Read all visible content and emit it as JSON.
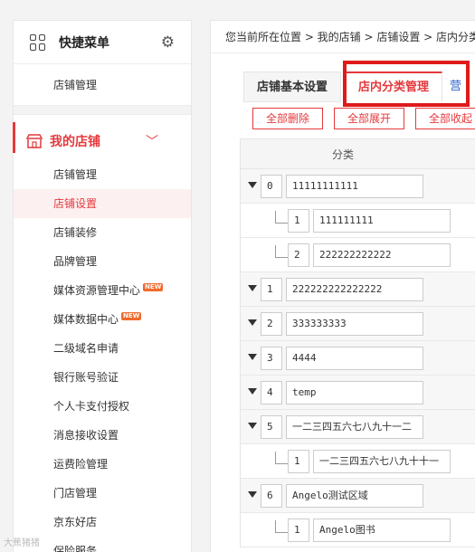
{
  "quick_menu": {
    "title": "快捷菜单",
    "items": [
      {
        "label": "店铺管理"
      }
    ]
  },
  "my_shop": {
    "title": "我的店铺",
    "items": [
      {
        "label": "店铺管理"
      },
      {
        "label": "店铺设置"
      },
      {
        "label": "店铺装修"
      },
      {
        "label": "品牌管理"
      },
      {
        "label": "媒体资源管理中心",
        "badge": "NEW"
      },
      {
        "label": "媒体数据中心",
        "badge": "NEW"
      },
      {
        "label": "二级域名申请"
      },
      {
        "label": "银行账号验证"
      },
      {
        "label": "个人卡支付授权"
      },
      {
        "label": "消息接收设置"
      },
      {
        "label": "运费险管理"
      },
      {
        "label": "门店管理"
      },
      {
        "label": "京东好店"
      },
      {
        "label": "保险服务"
      }
    ]
  },
  "breadcrumb": "您当前所在位置 > 我的店铺 > 店铺设置 > 店内分类",
  "tabs": [
    {
      "label": "店铺基本设置"
    },
    {
      "label": "店内分类管理"
    },
    {
      "label": "营"
    }
  ],
  "actions": {
    "delete_all": "全部删除",
    "expand_all": "全部展开",
    "collapse_all": "全部收起"
  },
  "table": {
    "header": "分类",
    "rows": [
      {
        "sort": "0",
        "name": "11111111111"
      },
      {
        "sort": "1",
        "name": "111111111"
      },
      {
        "sort": "2",
        "name": "222222222222"
      },
      {
        "sort": "1",
        "name": "222222222222222"
      },
      {
        "sort": "2",
        "name": "333333333"
      },
      {
        "sort": "3",
        "name": "4444"
      },
      {
        "sort": "4",
        "name": "temp"
      },
      {
        "sort": "5",
        "name": "一二三四五六七八九十一二"
      },
      {
        "sort": "1",
        "name": "一二三四五六七八九十十一"
      },
      {
        "sort": "6",
        "name": "Angelo测试区域"
      },
      {
        "sort": "1",
        "name": "Angelo图书"
      }
    ]
  },
  "watermark": "大蕉猪猪",
  "colors": {
    "accent": "#e4393c",
    "highlight_box": "#e01a1a",
    "badge": "#f26a2d"
  }
}
